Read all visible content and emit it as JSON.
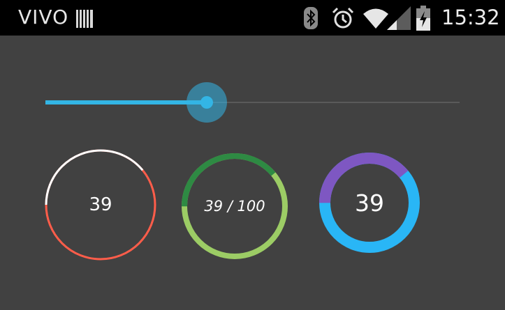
{
  "status_bar": {
    "carrier": "VIVO",
    "time": "15:32",
    "icons": [
      "sim-card-icon",
      "bluetooth-icon",
      "alarm-icon",
      "wifi-icon",
      "cell-signal-icon",
      "battery-charging-icon"
    ]
  },
  "slider": {
    "value": 39,
    "max": 100,
    "accent_color": "#33b5e5"
  },
  "progress_circles": [
    {
      "label": "39",
      "value": 39,
      "max": 100,
      "progress_color": "#ff5d4a",
      "remaining_color": "#ffffff"
    },
    {
      "label": "39 / 100",
      "value": 39,
      "max": 100,
      "progress_color": "#2e8a43",
      "remaining_color": "#9ccc65"
    },
    {
      "label": "39",
      "value": 39,
      "max": 100,
      "progress_color": "#7e57c2",
      "remaining_color": "#29b6f6"
    }
  ],
  "colors": {
    "background": "#414141",
    "status_bar": "#000000"
  }
}
